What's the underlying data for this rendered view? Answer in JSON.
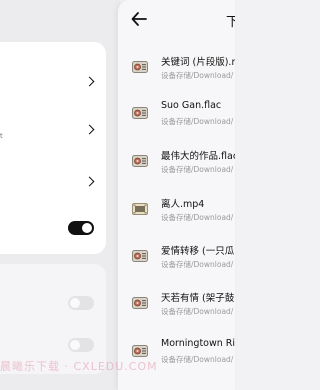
{
  "left": {
    "subtext": "t"
  },
  "download_list": {
    "title": "下",
    "files": [
      {
        "name": "关键词 (片段版).m",
        "path": "设备存储/Download/",
        "icon": "audio-file-icon"
      },
      {
        "name": "Suo Gan.flac",
        "path": "设备存储/Download/",
        "icon": "audio-file-icon"
      },
      {
        "name": "最伟大的作品.flac",
        "path": "设备存储/Download/",
        "icon": "audio-file-icon"
      },
      {
        "name": "离人.mp4",
        "path": "设备存储/Download/",
        "icon": "video-file-icon"
      },
      {
        "name": "爱情转移 (一只瓜",
        "path": "设备存储/Download/",
        "icon": "audio-file-icon"
      },
      {
        "name": "天若有情 (架子鼓",
        "path": "设备存储/Download/",
        "icon": "audio-file-icon"
      },
      {
        "name": "Morningtown Ride",
        "path": "设备存储/Download/",
        "icon": "audio-file-icon"
      }
    ]
  },
  "watermark": "晨曦乐下载 · CXLEDU.COM"
}
